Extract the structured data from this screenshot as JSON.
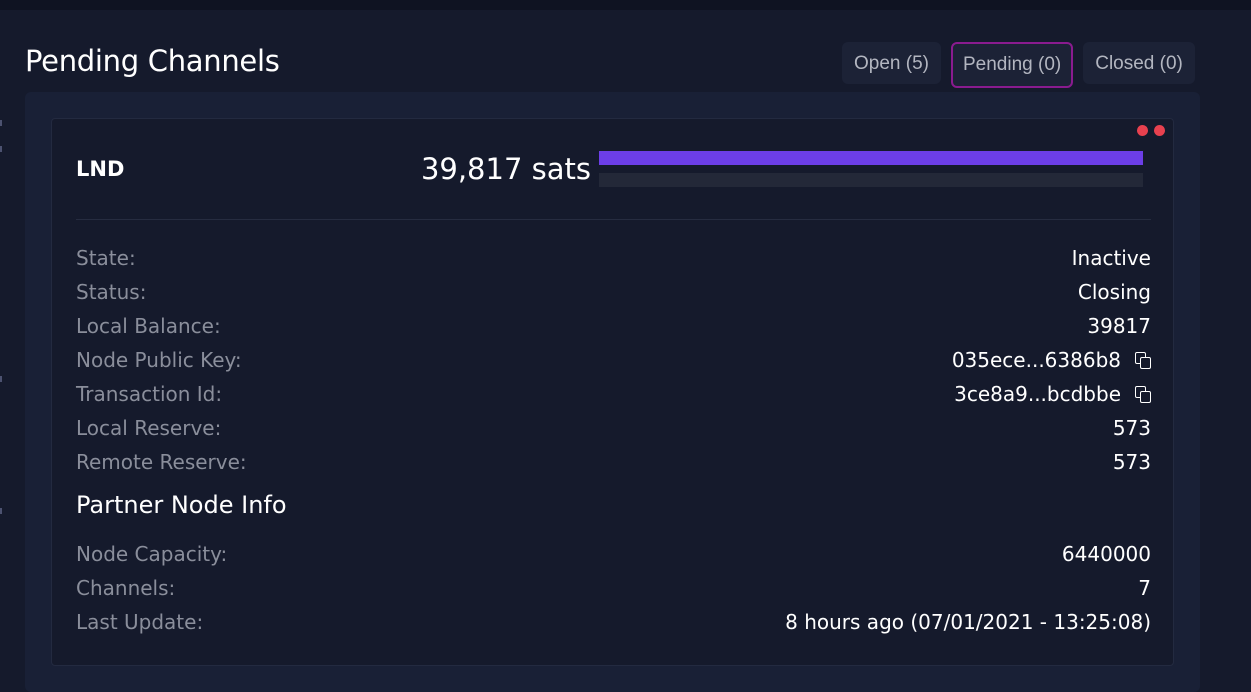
{
  "page": {
    "title": "Pending Channels"
  },
  "tabs": [
    {
      "label": "Open (5)",
      "active": false
    },
    {
      "label": "Pending (0)",
      "active": true
    },
    {
      "label": "Closed (0)",
      "active": false
    }
  ],
  "channel": {
    "node_name": "LND",
    "amount": "39,817 sats",
    "local_balance_fraction": 1.0,
    "details": [
      {
        "label": "State:",
        "value": "Inactive"
      },
      {
        "label": "Status:",
        "value": "Closing"
      },
      {
        "label": "Local Balance:",
        "value": "39817"
      },
      {
        "label": "Node Public Key:",
        "value": "035ece...6386b8",
        "copy": true
      },
      {
        "label": "Transaction Id:",
        "value": "3ce8a9...bcdbbe",
        "copy": true
      },
      {
        "label": "Local Reserve:",
        "value": "573"
      },
      {
        "label": "Remote Reserve:",
        "value": "573"
      }
    ],
    "partner_title": "Partner Node Info",
    "partner": [
      {
        "label": "Node Capacity:",
        "value": "6440000"
      },
      {
        "label": "Channels:",
        "value": "7"
      },
      {
        "label": "Last Update:",
        "value": "8 hours ago (07/01/2021 - 13:25:08)"
      }
    ]
  },
  "colors": {
    "background": "#151a2c",
    "accent_bar": "#6c3ee8",
    "active_tab_border": "#8a1b8f",
    "status_dot": "#e8414f"
  }
}
